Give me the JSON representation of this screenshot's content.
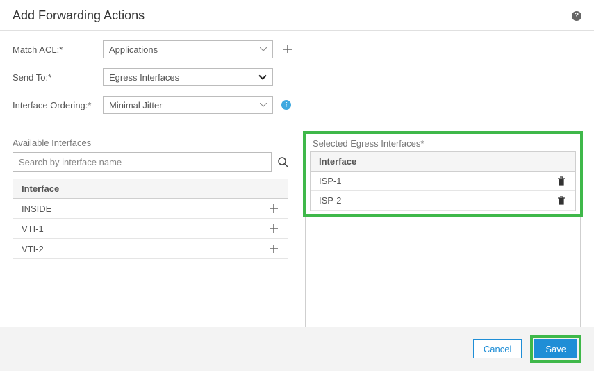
{
  "header": {
    "title": "Add Forwarding Actions",
    "help_icon": "?"
  },
  "form": {
    "match_acl": {
      "label": "Match ACL:*",
      "value": "Applications"
    },
    "send_to": {
      "label": "Send To:*",
      "value": "Egress Interfaces"
    },
    "ordering": {
      "label": "Interface Ordering:*",
      "value": "Minimal Jitter"
    }
  },
  "available": {
    "title": "Available Interfaces",
    "search_placeholder": "Search by interface name",
    "header": "Interface",
    "rows": [
      "INSIDE",
      "VTI-1",
      "VTI-2"
    ]
  },
  "selected": {
    "title": "Selected Egress Interfaces*",
    "header": "Interface",
    "rows": [
      "ISP-1",
      "ISP-2"
    ]
  },
  "footer": {
    "cancel": "Cancel",
    "save": "Save"
  }
}
